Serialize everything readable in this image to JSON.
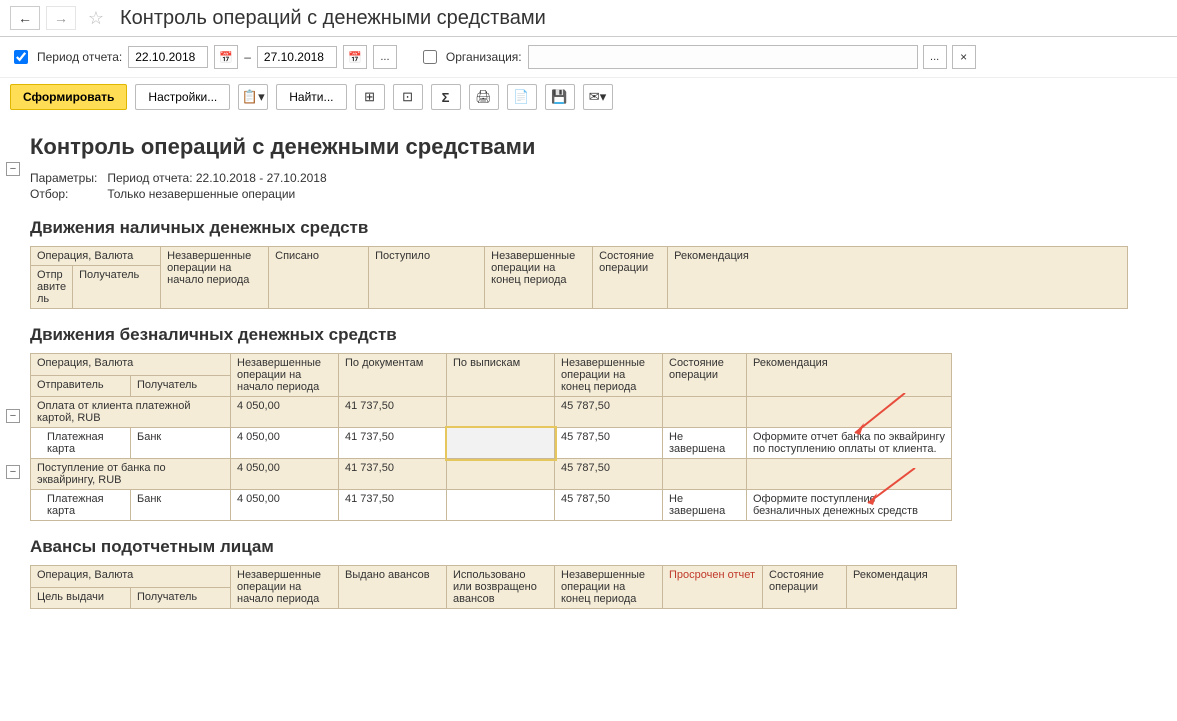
{
  "header": {
    "title": "Контроль операций с денежными средствами"
  },
  "params": {
    "period_label": "Период отчета:",
    "date_from": "22.10.2018",
    "dash": "–",
    "date_to": "27.10.2018",
    "org_label": "Организация:",
    "org_value": ""
  },
  "toolbar": {
    "generate": "Сформировать",
    "settings": "Настройки...",
    "find": "Найти..."
  },
  "report": {
    "title": "Контроль операций с денежными средствами",
    "meta": {
      "params_label": "Параметры:",
      "params_value": "Период отчета: 22.10.2018 - 27.10.2018",
      "filter_label": "Отбор:",
      "filter_value": "Только незавершенные операции"
    },
    "section1": {
      "title": "Движения наличных денежных средств",
      "headers": {
        "op": "Операция, Валюта",
        "sender": "Отпр\nавите\nль",
        "recipient": "Получатель",
        "pending_start": "Незавершенные\nоперации на\nначало периода",
        "written_off": "Списано",
        "received": "Поступило",
        "pending_end": "Незавершенные\nоперации на\nконец периода",
        "state": "Состояние\nоперации",
        "recommend": "Рекомендация"
      }
    },
    "section2": {
      "title": "Движения безналичных денежных средств",
      "headers": {
        "op": "Операция, Валюта",
        "sender": "Отправитель",
        "recipient": "Получатель",
        "pending_start": "Незавершенные\nоперации на\nначало периода",
        "by_docs": "По документам",
        "by_statements": "По выпискам",
        "pending_end": "Незавершенные\nоперации на\nконец периода",
        "state": "Состояние\nоперации",
        "recommend": "Рекомендация"
      },
      "rows": [
        {
          "type": "group",
          "op": "Оплата от клиента платежной картой, RUB",
          "pending_start": "4 050,00",
          "by_docs": "41 737,50",
          "by_statements": "",
          "pending_end": "45 787,50",
          "state": "",
          "recommend": ""
        },
        {
          "type": "leaf",
          "sender": "Платежная карта",
          "recipient": "Банк",
          "pending_start": "4 050,00",
          "by_docs": "41 737,50",
          "by_statements": "",
          "pending_end": "45 787,50",
          "state": "Не завершена",
          "recommend": "Оформите отчет банка по эквайрингу по поступлению оплаты от клиента."
        },
        {
          "type": "group",
          "op": "Поступление от банка по эквайрингу, RUB",
          "pending_start": "4 050,00",
          "by_docs": "41 737,50",
          "by_statements": "",
          "pending_end": "45 787,50",
          "state": "",
          "recommend": ""
        },
        {
          "type": "leaf",
          "sender": "Платежная карта",
          "recipient": "Банк",
          "pending_start": "4 050,00",
          "by_docs": "41 737,50",
          "by_statements": "",
          "pending_end": "45 787,50",
          "state": "Не завершена",
          "recommend": "Оформите поступление безналичных денежных средств"
        }
      ]
    },
    "section3": {
      "title": "Авансы подотчетным лицам",
      "headers": {
        "op": "Операция, Валюта",
        "purpose": "Цель выдачи",
        "recipient": "Получатель",
        "pending_start": "Незавершенные\nоперации на\nначало периода",
        "advances_issued": "Выдано авансов",
        "used_returned": "Использовано\nили возвращено\nавансов",
        "pending_end": "Незавершенные\nоперации на\nконец периода",
        "overdue": "Просрочен отчет",
        "state": "Состояние\nоперации",
        "recommend": "Рекомендация"
      }
    }
  }
}
